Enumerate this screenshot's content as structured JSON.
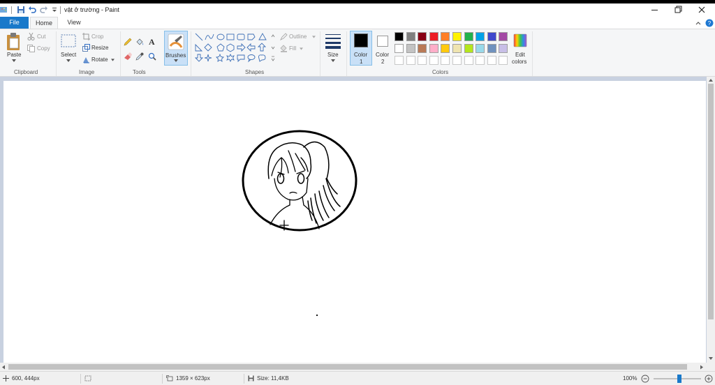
{
  "window": {
    "title": "vật ở trường - Paint"
  },
  "tabs": {
    "file": "File",
    "home": "Home",
    "view": "View"
  },
  "clipboard": {
    "paste": "Paste",
    "cut": "Cut",
    "copy": "Copy",
    "group": "Clipboard"
  },
  "image": {
    "select": "Select",
    "crop": "Crop",
    "resize": "Resize",
    "rotate": "Rotate",
    "group": "Image"
  },
  "tools": {
    "group": "Tools",
    "text_glyph": "A"
  },
  "brushes": {
    "label": "Brushes"
  },
  "shapes": {
    "outline": "Outline",
    "fill": "Fill",
    "group": "Shapes"
  },
  "size": {
    "label": "Size"
  },
  "colors": {
    "color1": "Color",
    "color1_num": "1",
    "color2": "Color",
    "color2_num": "2",
    "edit_line1": "Edit",
    "edit_line2": "colors",
    "group": "Colors",
    "color1_value": "#000000",
    "color2_value": "#ffffff",
    "palette_row1": [
      "#000000",
      "#7f7f7f",
      "#880015",
      "#ed1c24",
      "#ff7f27",
      "#fff200",
      "#22b14c",
      "#00a2e8",
      "#3f48cc",
      "#a349a4"
    ],
    "palette_row2": [
      "#ffffff",
      "#c3c3c3",
      "#b97a57",
      "#ffaec9",
      "#ffc90e",
      "#efe4b0",
      "#b5e61d",
      "#99d9ea",
      "#7092be",
      "#c8bfe7"
    ]
  },
  "status": {
    "cursor": "600, 444px",
    "canvas_size": "1359 × 623px",
    "file_size": "Size: 11,4KB",
    "zoom": "100%",
    "zoom_level": 0.55
  },
  "theme": {
    "accent": "#1979ca",
    "workspace": "#c8d1e0"
  }
}
